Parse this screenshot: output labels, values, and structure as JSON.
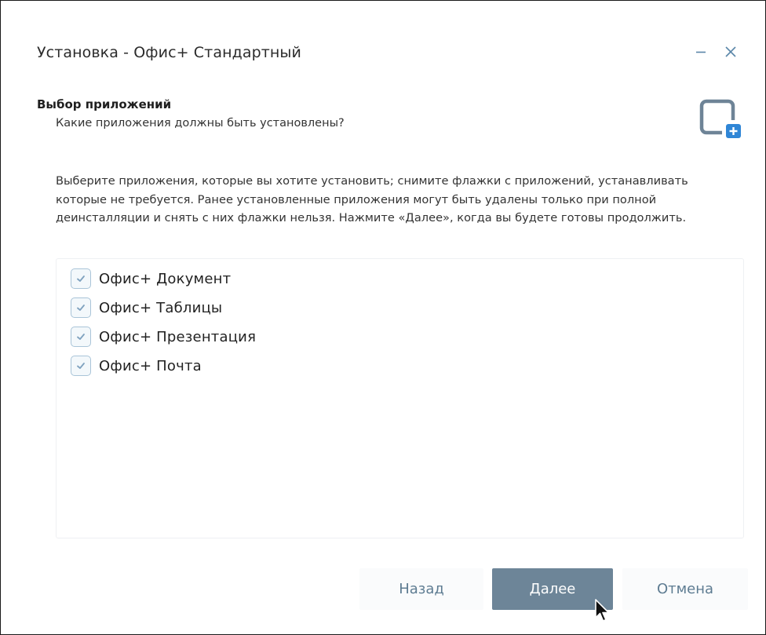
{
  "window": {
    "title": "Установка - Офис+ Стандартный",
    "minimize_symbol": "–",
    "close_symbol": "×"
  },
  "header": {
    "section_title": "Выбор приложений",
    "section_subtitle": "Какие приложения должны быть установлены?",
    "icon": "window-add-icon"
  },
  "description": "Выберите приложения, которые вы хотите установить; снимите флажки с приложений, устанавливать которые не требуется. Ранее установленные приложения могут быть удалены только при полной деинсталляции и снять с них флажки нельзя. Нажмите «Далее», когда вы будете готовы продолжить.",
  "components": [
    {
      "label": "Офис+ Документ",
      "checked": true
    },
    {
      "label": "Офис+ Таблицы",
      "checked": true
    },
    {
      "label": "Офис+ Презентация",
      "checked": true
    },
    {
      "label": "Офис+ Почта",
      "checked": true
    }
  ],
  "buttons": {
    "back": "Назад",
    "next": "Далее",
    "cancel": "Отмена"
  },
  "colors": {
    "accent": "#6d8598",
    "icon_outline": "#6e8497",
    "icon_badge": "#2f86d6",
    "checkbox_border": "#a9c4d8",
    "checkmark": "#7fa2bf",
    "secondary_button_text": "#5e7c92"
  }
}
